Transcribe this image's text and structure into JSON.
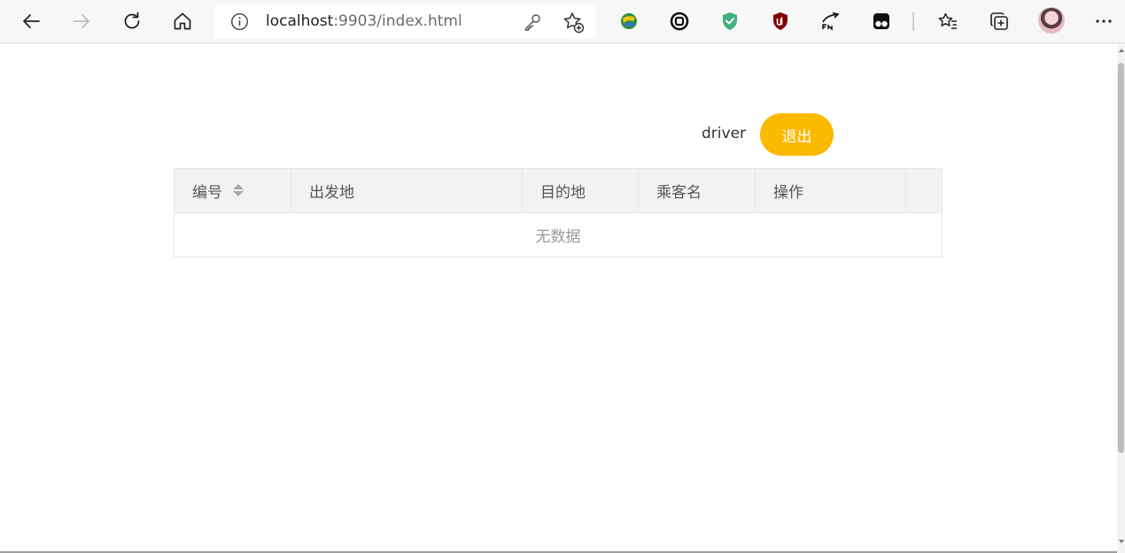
{
  "browser": {
    "address": {
      "host": "localhost",
      "rest": ":9903/index.html"
    },
    "icons": [
      "back-icon",
      "forward-icon",
      "refresh-icon",
      "home-icon",
      "site-info-icon",
      "password-key-icon",
      "add-favorite-icon",
      "extension-idm-icon",
      "extension-link-icon",
      "extension-shield-icon",
      "extension-ublock-icon",
      "extension-translate-icon",
      "extension-tampermonkey-icon",
      "favorites-icon",
      "collections-icon",
      "profile-avatar",
      "more-icon"
    ]
  },
  "header": {
    "username": "driver",
    "logout_label": "退出",
    "logout_color": "#fbb900"
  },
  "table": {
    "columns": [
      "编号",
      "出发地",
      "目的地",
      "乘客名",
      "操作",
      ""
    ],
    "sortable_column": "编号",
    "empty_text": "无数据"
  }
}
